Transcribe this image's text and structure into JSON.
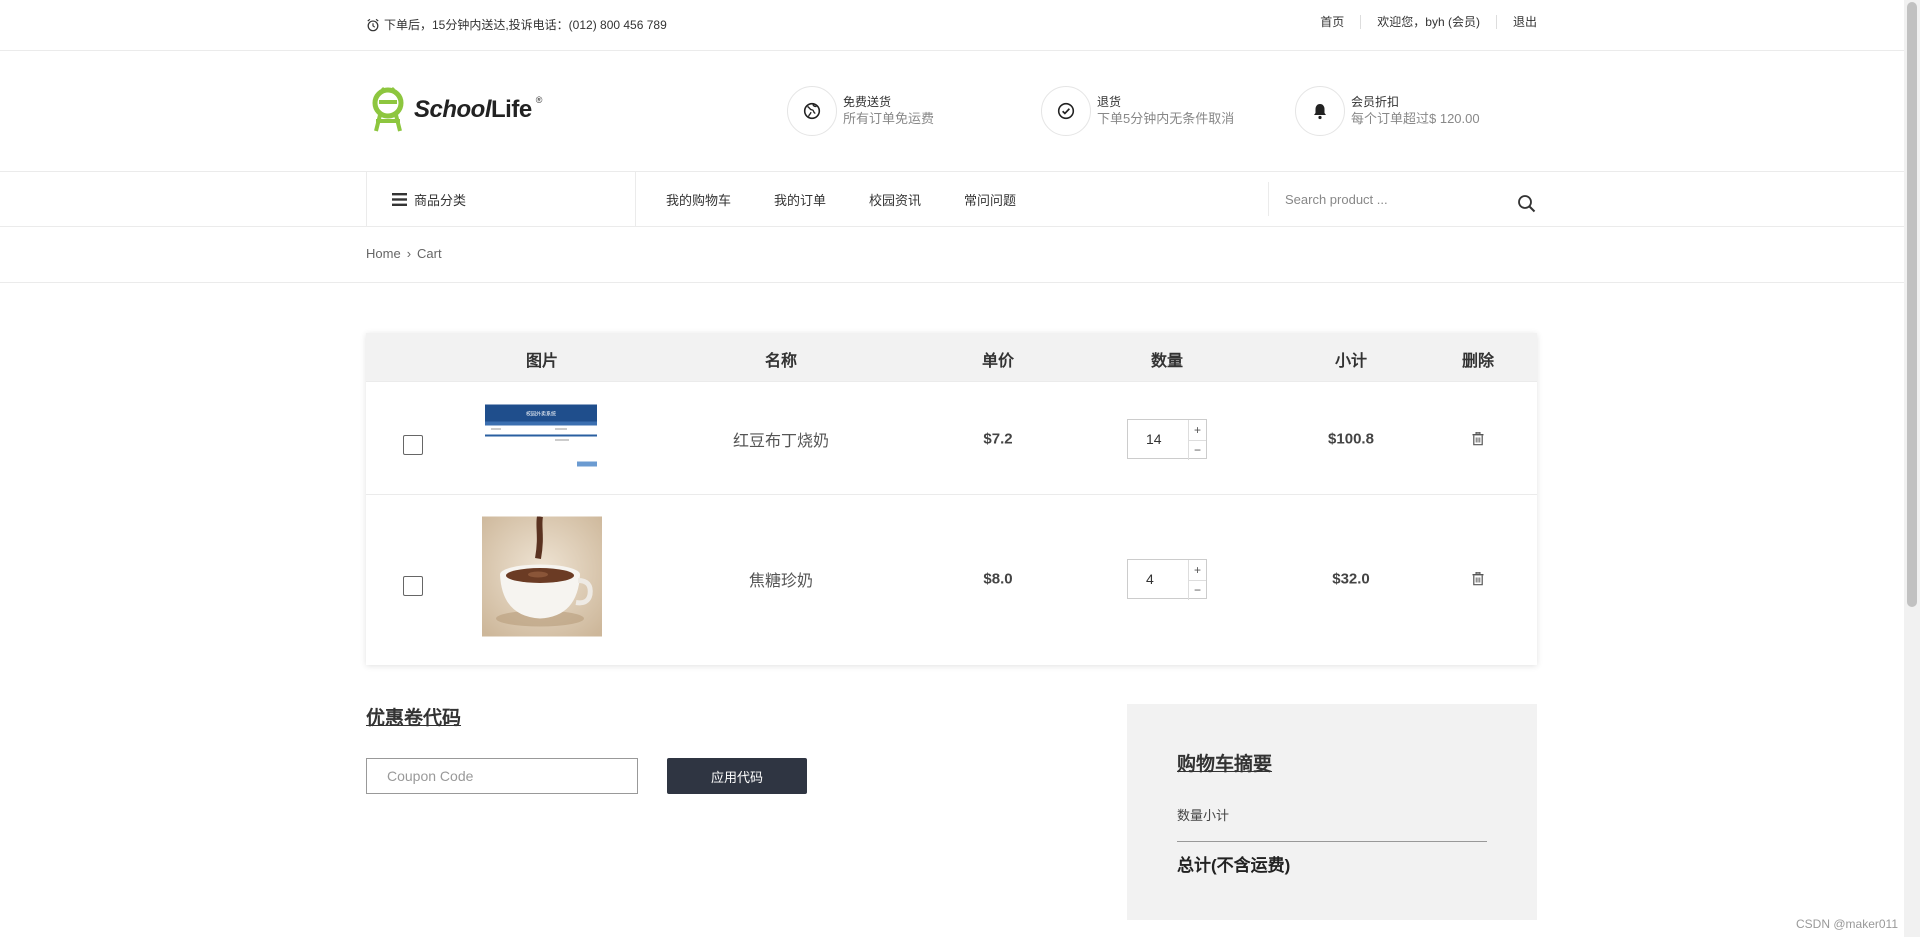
{
  "topbar": {
    "notice": "下单后，15分钟内送达,投诉电话：(012) 800 456 789",
    "links": [
      "首页",
      "欢迎您，byh (会员)",
      "退出"
    ]
  },
  "header": {
    "logo_school": "School",
    "logo_life": "Life",
    "logo_reg": "®",
    "features": [
      {
        "title": "免费送货",
        "desc": "所有订单免运费",
        "icon": "globe-icon"
      },
      {
        "title": "退货",
        "desc": "下单5分钟内无条件取消",
        "icon": "check-circle-icon"
      },
      {
        "title": "会员折扣",
        "desc": "每个订单超过$ 120.00",
        "icon": "bell-icon"
      }
    ]
  },
  "nav": {
    "category_label": "商品分类",
    "menu": [
      "我的购物车",
      "我的订单",
      "校园资讯",
      "常问问题"
    ],
    "search_placeholder": "Search product ..."
  },
  "breadcrumb": {
    "home": "Home",
    "separator": "›",
    "current": "Cart"
  },
  "cart": {
    "headers": {
      "image": "图片",
      "name": "名称",
      "price": "单价",
      "qty": "数量",
      "subtotal": "小计",
      "delete": "删除"
    },
    "items": [
      {
        "name": "红豆布丁烧奶",
        "price": "$7.2",
        "qty": "14",
        "subtotal": "$100.8",
        "thumb_title": "校园外卖系统"
      },
      {
        "name": "焦糖珍奶",
        "price": "$8.0",
        "qty": "4",
        "subtotal": "$32.0"
      }
    ],
    "plus": "+",
    "minus": "−"
  },
  "coupon": {
    "title": "优惠卷代码",
    "placeholder": "Coupon Code",
    "button": "应用代码"
  },
  "summary": {
    "title": "购物车摘要",
    "qty_subtotal_label": "数量小计",
    "total_label": "总计(不含运费)"
  },
  "watermark": "CSDN @maker011",
  "colors": {
    "logo_green": "#8dc63f",
    "button_dark": "#2f3542",
    "table_head_bg": "#f2f2f2"
  }
}
